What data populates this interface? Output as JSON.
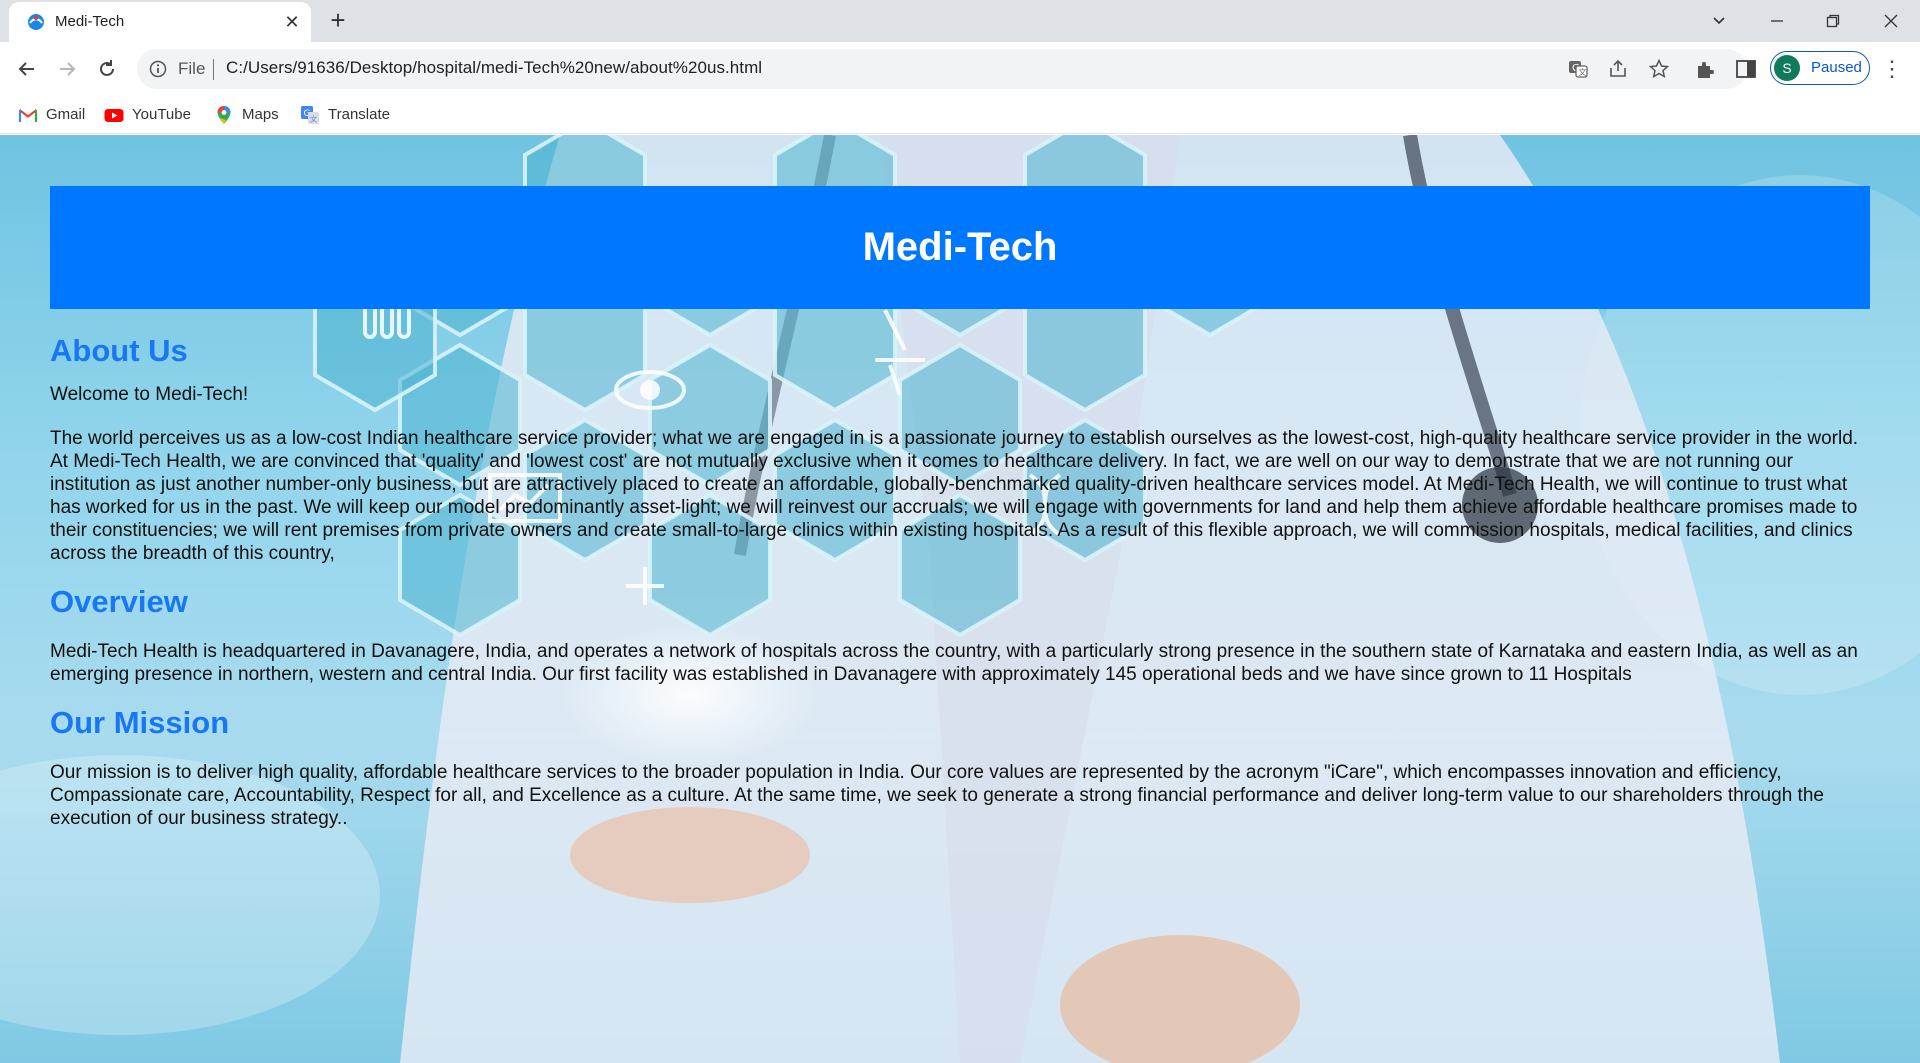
{
  "browser": {
    "tab_title": "Medi-Tech",
    "omnibox": {
      "chip": "File",
      "url": "C:/Users/91636/Desktop/hospital/medi-Tech%20new/about%20us.html"
    },
    "profile": {
      "initial": "S",
      "label": "Paused"
    },
    "bookmarks": [
      {
        "label": "Gmail",
        "icon": "gmail-icon"
      },
      {
        "label": "YouTube",
        "icon": "youtube-icon"
      },
      {
        "label": "Maps",
        "icon": "maps-icon"
      },
      {
        "label": "Translate",
        "icon": "translate-icon"
      }
    ]
  },
  "page": {
    "header_title": "Medi-Tech",
    "about": {
      "heading": "About Us",
      "welcome": "Welcome to Medi-Tech!",
      "body": "The world perceives us as a low-cost Indian healthcare service provider; what we are engaged in is a passionate journey to establish ourselves as the lowest-cost, high-quality healthcare service provider in the world. At Medi-Tech Health, we are convinced that 'quality' and 'lowest cost' are not mutually exclusive when it comes to healthcare delivery. In fact, we are well on our way to demonstrate that we are not running our institution as just another number-only business, but are attractively placed to create an affordable, globally-benchmarked quality-driven healthcare services model. At Medi-Tech Health, we will continue to trust what has worked for us in the past. We will keep our model predominantly asset-light; we will reinvest our accruals; we will engage with governments for land and help them achieve affordable healthcare promises made to their constituencies; we will rent premises from private owners and create small-to-large clinics within existing hospitals. As a result of this flexible approach, we will commission hospitals, medical facilities, and clinics across the breadth of this country,"
    },
    "overview": {
      "heading": "Overview",
      "body": "Medi-Tech Health is headquartered in Davanagere, India, and operates a network of hospitals across the country, with a particularly strong presence in the southern state of Karnataka and eastern India, as well as an emerging presence in northern, western and central India. Our first facility was established in Davanagere with approximately 145 operational beds and we have since grown to 11 Hospitals"
    },
    "mission": {
      "heading": "Our Mission",
      "body": "Our mission is to deliver high quality, affordable healthcare services to the broader population in India. Our core values are represented by the acronym \"iCare\", which encompasses innovation and efficiency, Compassionate care, Accountability, Respect for all, and Excellence as a culture. At the same time, we seek to generate a strong financial performance and deliver long-term value to our shareholders through the execution of our business strategy.."
    }
  },
  "colors": {
    "header_bg": "#0077ff",
    "heading_text": "#1877f2",
    "tabstrip_bg": "#dee1e6",
    "profile_accent": "#0b57d0"
  }
}
